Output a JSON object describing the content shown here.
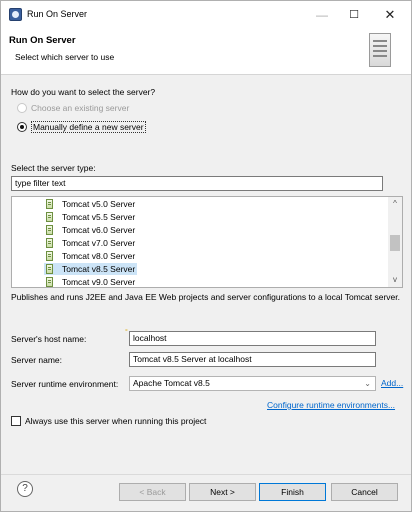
{
  "window": {
    "title": "Run On Server",
    "minimize_icon": "minimize-icon",
    "maximize_icon": "maximize-icon",
    "close_icon": "close-icon",
    "min_glyph": "—",
    "max_glyph": "☐",
    "close_glyph": "✕"
  },
  "header": {
    "title": "Run On Server",
    "description": "Select which server to use"
  },
  "selection": {
    "question": "How do you want to select the server?",
    "options": [
      {
        "label": "Choose an existing server",
        "checked": false,
        "enabled": false
      },
      {
        "label": "Manually define a new server",
        "checked": true,
        "enabled": true
      }
    ]
  },
  "server_type": {
    "label": "Select the server type:",
    "filter_value": "type filter text",
    "items": [
      "Tomcat v5.0 Server",
      "Tomcat v5.5 Server",
      "Tomcat v6.0 Server",
      "Tomcat v7.0 Server",
      "Tomcat v8.0 Server",
      "Tomcat v8.5 Server",
      "Tomcat v9.0 Server"
    ],
    "selected_index": 5,
    "scroll_up": "^",
    "scroll_down": "v",
    "description": "Publishes and runs J2EE and Java EE Web projects and server configurations to a local Tomcat server."
  },
  "fields": {
    "host_label": "Server's host name:",
    "host_value": "localhost",
    "name_label": "Server name:",
    "name_value": "Tomcat v8.5 Server at localhost",
    "runtime_label": "Server runtime environment:",
    "runtime_value": "Apache Tomcat v8.5",
    "runtime_arrow": "⌄",
    "add_link": "Add...",
    "configure_link": "Configure runtime environments...",
    "warn_glyph": "°"
  },
  "always_use": {
    "label": "Always use this server when running this project",
    "checked": false
  },
  "footer": {
    "help_glyph": "?",
    "back": "< Back",
    "next": "Next >",
    "finish": "Finish",
    "cancel": "Cancel"
  }
}
